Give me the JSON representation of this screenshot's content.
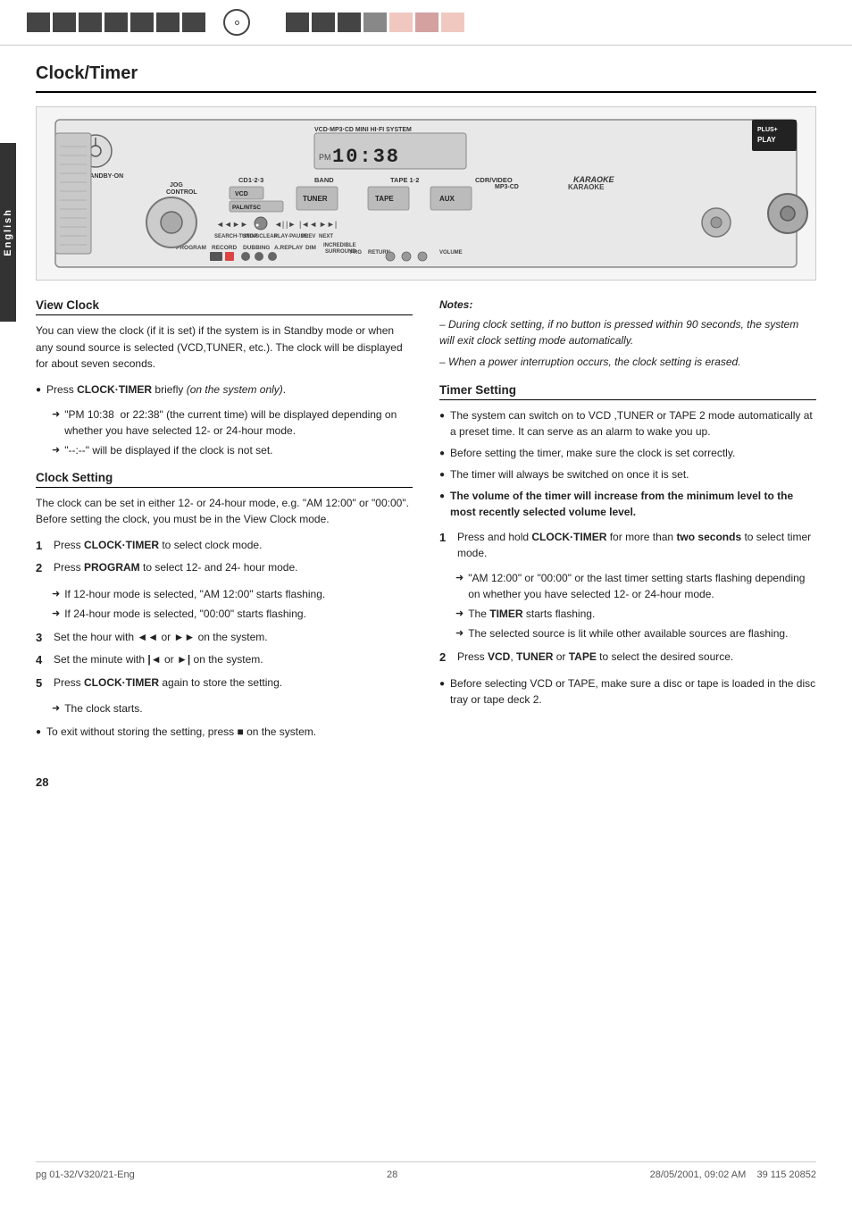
{
  "page": {
    "title": "Clock/Timer",
    "number": "28",
    "file_info": "pg 01-32/V320/21-Eng",
    "page_num": "28",
    "date_info": "28/05/2001, 09:02 AM",
    "print_info": "39 115 20852"
  },
  "top_bar": {
    "left_stripes": [
      "dark",
      "dark",
      "dark",
      "dark",
      "dark",
      "dark",
      "dark"
    ],
    "right_stripes": [
      "dark",
      "dark",
      "dark",
      "pink",
      "light",
      "pink",
      "light"
    ]
  },
  "device": {
    "model": "VCD MP3-CD MINI HI-FI SYSTEM",
    "clock_display": "PM 10:38",
    "pm_prefix": "PM",
    "time": "10:38",
    "brand": "KARAOKE",
    "standby_label": "STANDBY·ON"
  },
  "view_clock": {
    "heading": "View Clock",
    "paragraph": "You can view the clock (if it is set) if the system is in Standby mode or when any sound source is selected (VCD,TUNER, etc.). The clock will be displayed for about seven seconds.",
    "bullets": [
      {
        "text": "Press CLOCK·TIMER briefly (on the system only)."
      }
    ],
    "arrow1": "\"PM 10:38  or 22:38\" (the current time) will be displayed depending on whether you have selected 12- or 24-hour mode.",
    "arrow2": "\"--:--\" will be displayed if the clock is not set."
  },
  "clock_setting": {
    "heading": "Clock Setting",
    "paragraph": "The clock can be set in either 12- or 24-hour mode, e.g. \"AM 12:00\" or \"00:00\". Before setting the clock, you must be in the View Clock mode.",
    "steps": [
      {
        "num": "1",
        "text": "Press CLOCK·TIMER to select clock mode."
      },
      {
        "num": "2",
        "text": "Press PROGRAM to select 12- and 24- hour mode."
      }
    ],
    "step2_arrows": [
      "If 12-hour mode is selected, \"AM 12:00\" starts flashing.",
      "If 24-hour mode is selected, \"00:00\" starts flashing."
    ],
    "steps_cont": [
      {
        "num": "3",
        "text": "Set the hour with ◄◄ or ►► on the system."
      },
      {
        "num": "4",
        "text": "Set the minute with |◄ or ►| on the system."
      },
      {
        "num": "5",
        "text": "Press CLOCK·TIMER again to store the setting."
      }
    ],
    "step5_arrow": "The clock starts.",
    "bullet_exit": "To exit without storing the setting, press ■ on the system."
  },
  "notes": {
    "title": "Notes:",
    "items": [
      "– During clock setting, if no button is pressed within 90 seconds, the system will exit clock setting mode automatically.",
      "– When a power interruption occurs, the clock setting is erased."
    ]
  },
  "timer_setting": {
    "heading": "Timer Setting",
    "bullets": [
      "The system can switch on to VCD ,TUNER or TAPE 2 mode automatically at a preset time. It can serve as an alarm to wake you up.",
      "Before setting the timer, make sure the clock is set correctly.",
      "The timer will always be switched on once it is set."
    ],
    "bold_bullet": "The volume of the timer will increase from the minimum level to the most recently selected volume level.",
    "steps": [
      {
        "num": "1",
        "text": "Press and hold CLOCK·TIMER for more than two seconds to select timer mode."
      }
    ],
    "step1_arrows": [
      "\"AM 12:00\" or \"00:00\" or the last timer setting starts flashing depending on whether you have selected 12- or 24-hour mode.",
      "The TIMER starts flashing.",
      "The selected source is lit while other available sources are flashing."
    ],
    "steps_cont": [
      {
        "num": "2",
        "text": "Press VCD, TUNER or TAPE to select the desired source."
      }
    ],
    "bullet_vcd": "Before selecting VCD or TAPE, make sure a disc or tape is loaded in the disc tray or tape deck 2."
  }
}
